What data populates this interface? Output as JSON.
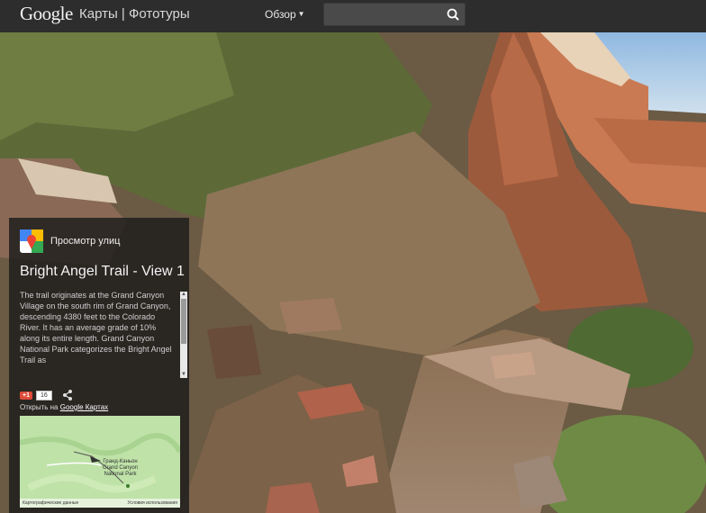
{
  "header": {
    "logo": "Google",
    "product": "Карты | Фототуры",
    "overview_label": "Обзор",
    "search": {
      "value": "",
      "placeholder": ""
    }
  },
  "panel": {
    "streetview_label": "Просмотр улиц",
    "title": "Bright Angel Trail - View 1",
    "description": "The trail originates at the Grand Canyon Village on the south rim of Grand Canyon, descending 4380 feet to the Colorado River. It has an average grade of 10% along its entire length. Grand Canyon National Park categorizes the Bright Angel Trail as",
    "gplus_label": "+1",
    "gplus_count": "16",
    "open_prefix": "Открыть на",
    "open_link": "Google Картах",
    "map": {
      "place_line1": "Гранд-Каньон",
      "place_line2": "Grand Canyon",
      "place_line3": "National Park",
      "footer_left": "Картографические данные",
      "footer_right": "Условия использования"
    }
  },
  "colors": {
    "topbar": "#2d2d2d",
    "gplus": "#dd4b39",
    "map_green": "#bfe2a8",
    "accent_streetview": "#4285f4"
  }
}
